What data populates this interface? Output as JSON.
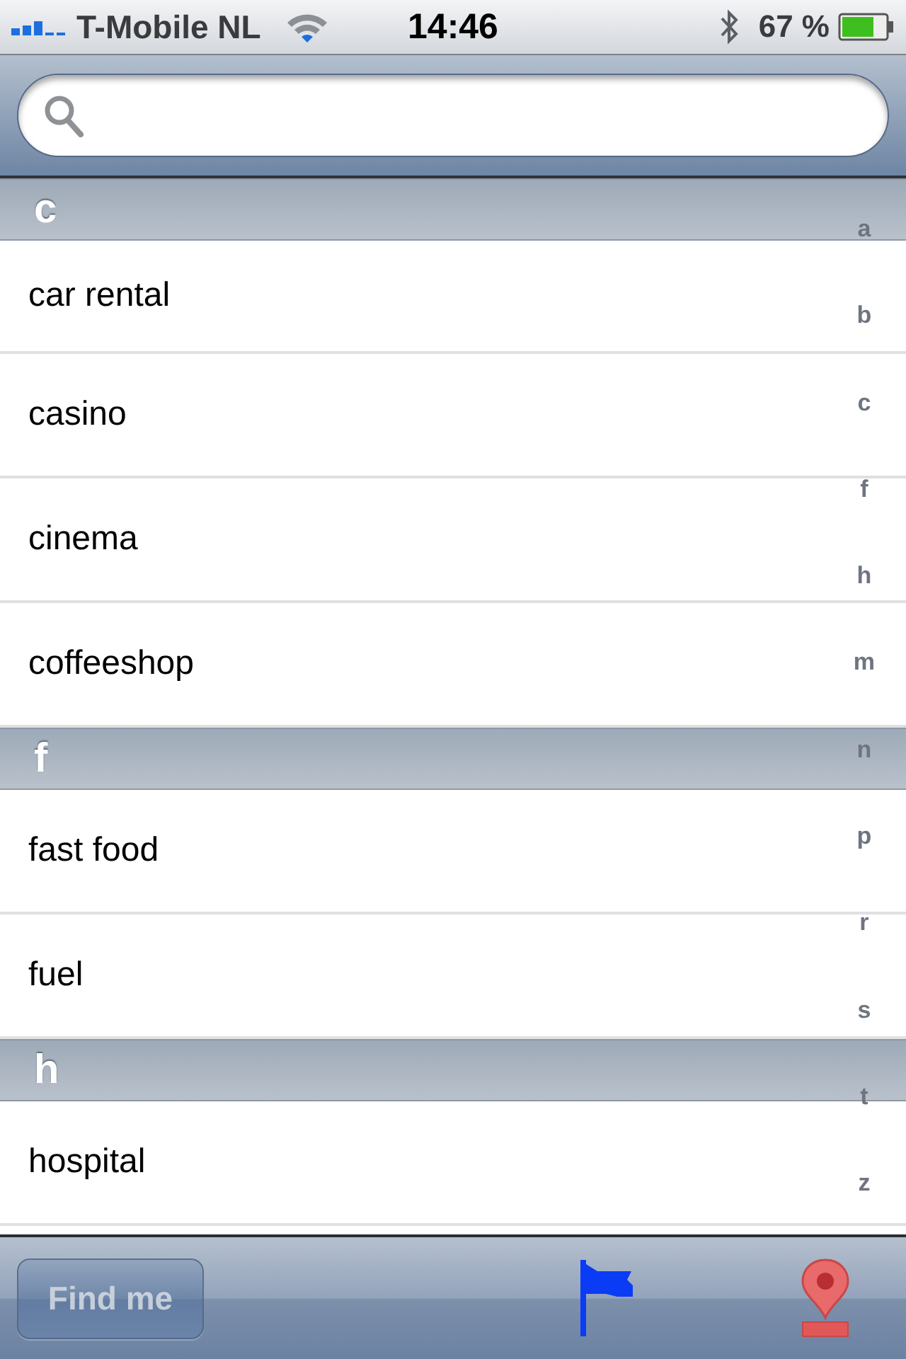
{
  "status_bar": {
    "carrier": "T-Mobile NL",
    "time": "14:46",
    "battery": "67 %"
  },
  "sections": [
    {
      "letter": "c",
      "items": [
        "car rental",
        "casino",
        "cinema",
        "coffeeshop"
      ]
    },
    {
      "letter": "f",
      "items": [
        "fast food",
        "fuel"
      ]
    },
    {
      "letter": "h",
      "items": [
        "hospital"
      ]
    }
  ],
  "index": [
    "a",
    "b",
    "c",
    "f",
    "h",
    "m",
    "n",
    "p",
    "r",
    "s",
    "t",
    "z"
  ],
  "toolbar": {
    "find_button": {
      "label": "Find me",
      "disabled": true
    }
  }
}
